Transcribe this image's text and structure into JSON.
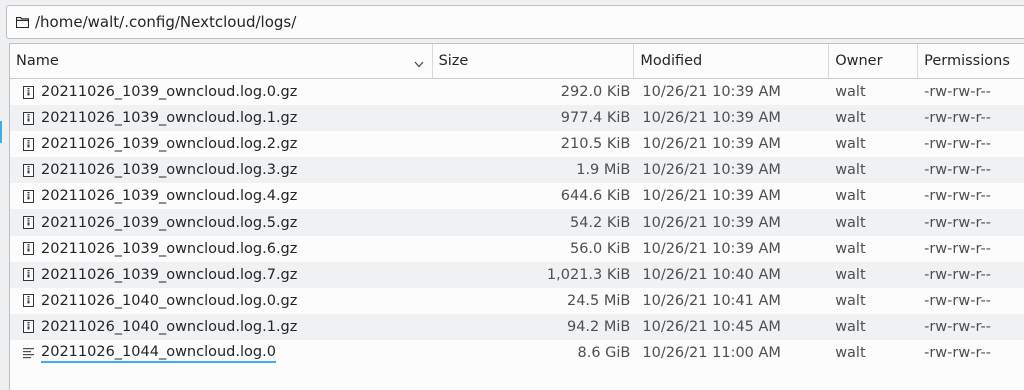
{
  "location": {
    "path": "/home/walt/.config/Nextcloud/logs/"
  },
  "columns": {
    "name": "Name",
    "size": "Size",
    "modified": "Modified",
    "owner": "Owner",
    "permissions": "Permissions"
  },
  "files": [
    {
      "name": "20211026_1039_owncloud.log.0.gz",
      "size": "292.0 KiB",
      "modified": "10/26/21 10:39 AM",
      "owner": "walt",
      "permissions": "-rw-rw-r--",
      "icon": "archive-icon"
    },
    {
      "name": "20211026_1039_owncloud.log.1.gz",
      "size": "977.4 KiB",
      "modified": "10/26/21 10:39 AM",
      "owner": "walt",
      "permissions": "-rw-rw-r--",
      "icon": "archive-icon"
    },
    {
      "name": "20211026_1039_owncloud.log.2.gz",
      "size": "210.5 KiB",
      "modified": "10/26/21 10:39 AM",
      "owner": "walt",
      "permissions": "-rw-rw-r--",
      "icon": "archive-icon"
    },
    {
      "name": "20211026_1039_owncloud.log.3.gz",
      "size": "1.9 MiB",
      "modified": "10/26/21 10:39 AM",
      "owner": "walt",
      "permissions": "-rw-rw-r--",
      "icon": "archive-icon"
    },
    {
      "name": "20211026_1039_owncloud.log.4.gz",
      "size": "644.6 KiB",
      "modified": "10/26/21 10:39 AM",
      "owner": "walt",
      "permissions": "-rw-rw-r--",
      "icon": "archive-icon"
    },
    {
      "name": "20211026_1039_owncloud.log.5.gz",
      "size": "54.2 KiB",
      "modified": "10/26/21 10:39 AM",
      "owner": "walt",
      "permissions": "-rw-rw-r--",
      "icon": "archive-icon"
    },
    {
      "name": "20211026_1039_owncloud.log.6.gz",
      "size": "56.0 KiB",
      "modified": "10/26/21 10:39 AM",
      "owner": "walt",
      "permissions": "-rw-rw-r--",
      "icon": "archive-icon"
    },
    {
      "name": "20211026_1039_owncloud.log.7.gz",
      "size": "1,021.3 KiB",
      "modified": "10/26/21 10:40 AM",
      "owner": "walt",
      "permissions": "-rw-rw-r--",
      "icon": "archive-icon"
    },
    {
      "name": "20211026_1040_owncloud.log.0.gz",
      "size": "24.5 MiB",
      "modified": "10/26/21 10:41 AM",
      "owner": "walt",
      "permissions": "-rw-rw-r--",
      "icon": "archive-icon"
    },
    {
      "name": "20211026_1040_owncloud.log.1.gz",
      "size": "94.2 MiB",
      "modified": "10/26/21 10:45 AM",
      "owner": "walt",
      "permissions": "-rw-rw-r--",
      "icon": "archive-icon"
    },
    {
      "name": "20211026_1044_owncloud.log.0",
      "size": "8.6 GiB",
      "modified": "10/26/21 11:00 AM",
      "owner": "walt",
      "permissions": "-rw-rw-r--",
      "icon": "text-file-icon"
    }
  ],
  "colors": {
    "accent": "#3daee9",
    "alt_row": "#f0f1f2",
    "background": "#fcfcfc"
  }
}
